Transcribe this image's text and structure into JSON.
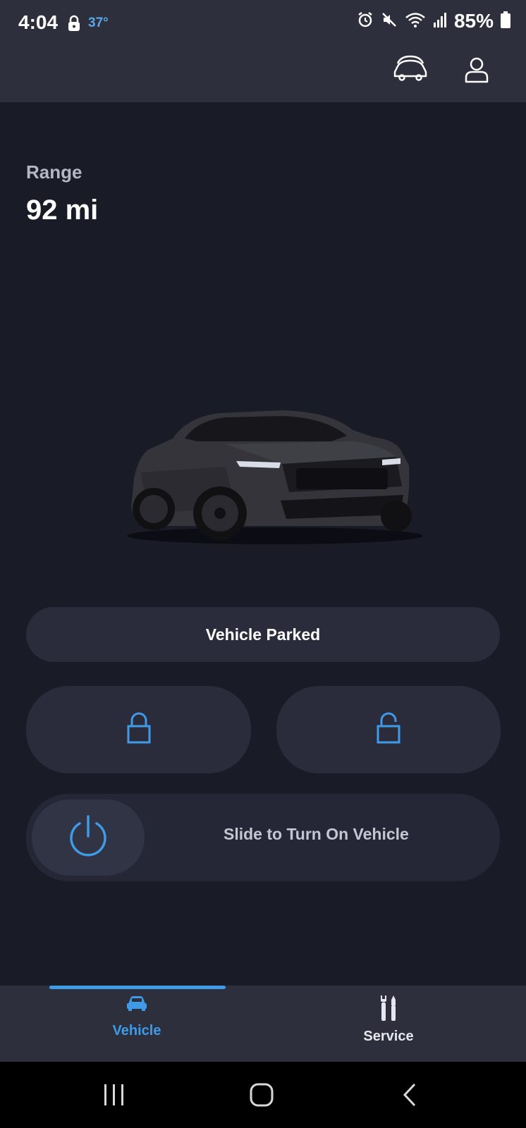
{
  "status_bar": {
    "time": "4:04",
    "temperature": "37°",
    "battery": "85%"
  },
  "header": {
    "vehicles_icon": "car-switch-icon",
    "account_icon": "account-icon"
  },
  "range": {
    "label": "Range",
    "value": "92 mi"
  },
  "vehicle_status": "Vehicle Parked",
  "controls": {
    "lock_icon": "lock-icon",
    "unlock_icon": "unlock-icon",
    "slider_label": "Slide to Turn On Vehicle"
  },
  "bottom_nav": {
    "items": [
      {
        "label": "Vehicle",
        "icon": "car-icon",
        "active": true
      },
      {
        "label": "Service",
        "icon": "tools-icon",
        "active": false
      }
    ]
  },
  "colors": {
    "accent": "#3f9be8",
    "background": "#191b27",
    "surface": "#2d2f3d"
  }
}
